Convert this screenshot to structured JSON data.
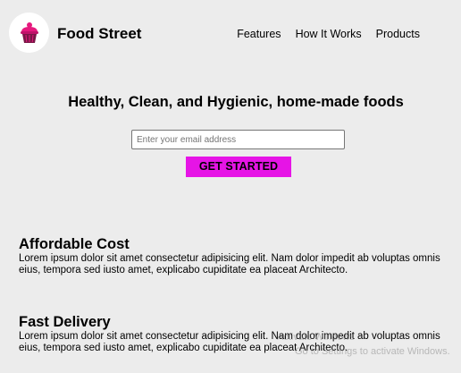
{
  "header": {
    "logo_icon": "pink-cupcake-logo-icon",
    "brand": "Food Street",
    "nav": [
      {
        "label": "Features"
      },
      {
        "label": "How It Works"
      },
      {
        "label": "Products"
      }
    ]
  },
  "hero": {
    "title": "Healthy, Clean, and Hygienic, home-made foods",
    "email_placeholder": "Enter your email address",
    "email_value": "",
    "cta_label": "GET STARTED"
  },
  "features": [
    {
      "title": "Affordable Cost",
      "text": "Lorem ipsum dolor sit amet consectetur adipisicing elit. Nam dolor impedit ab voluptas omnis eius, tempora sed iusto amet, explicabo cupiditate ea placeat Architecto."
    },
    {
      "title": "Fast Delivery",
      "text": "Lorem ipsum dolor sit amet consectetur adipisicing elit. Nam dolor impedit ab voluptas omnis eius, tempora sed iusto amet, explicabo cupiditate ea placeat Architecto."
    }
  ],
  "watermark": {
    "line1": "Activate Windows",
    "line2": "Go to Settings to activate Windows."
  },
  "colors": {
    "background": "#ececec",
    "cta": "#e614e6",
    "logo_accent": "#e6197e"
  }
}
